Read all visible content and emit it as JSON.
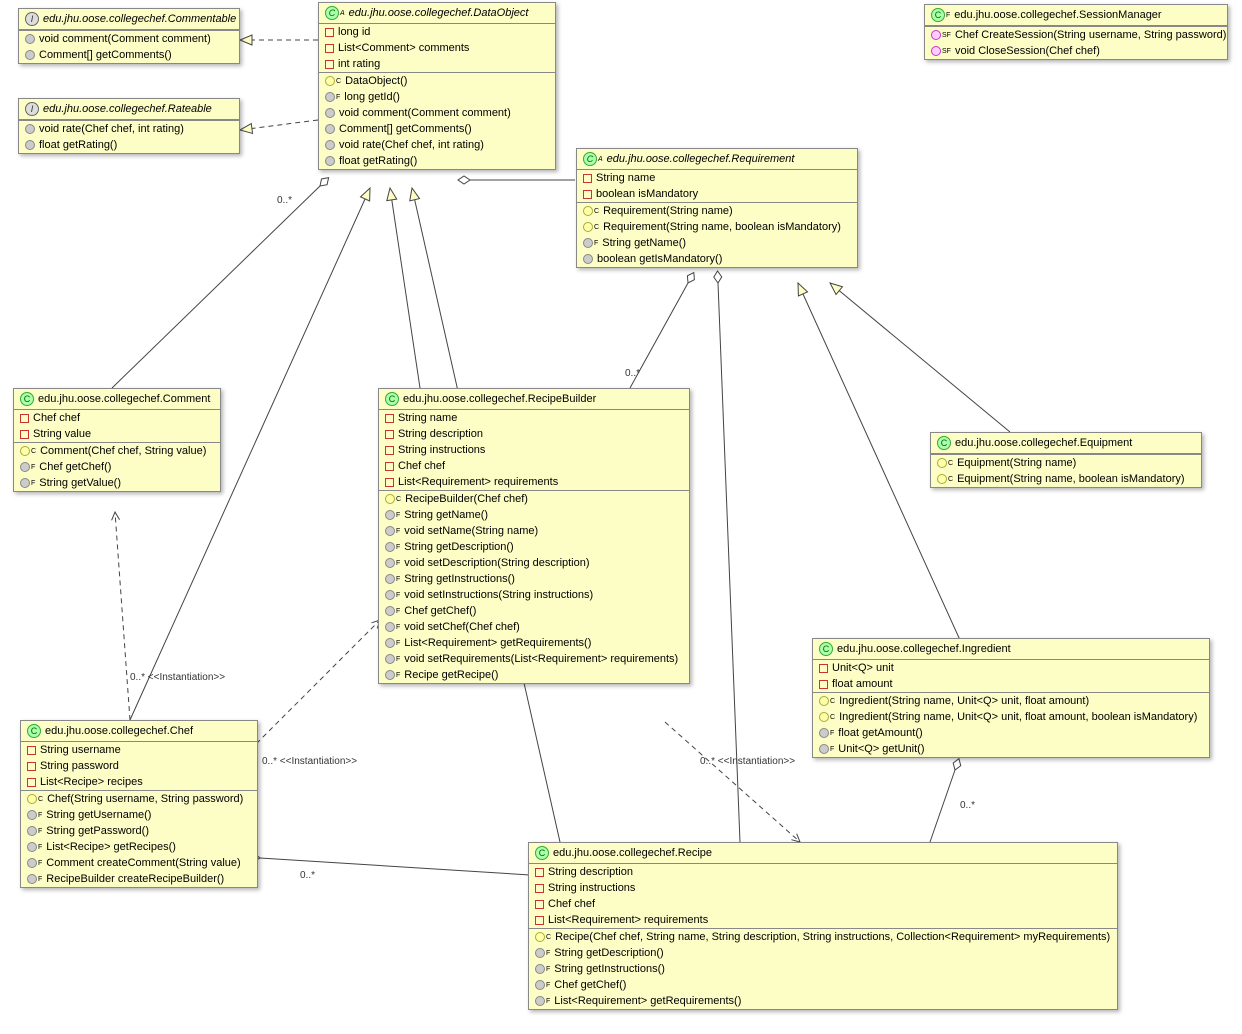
{
  "classes": {
    "commentable": {
      "title": "edu.jhu.oose.collegechef.Commentable",
      "methods": [
        "void comment(Comment comment)",
        "Comment[] getComments()"
      ]
    },
    "rateable": {
      "title": "edu.jhu.oose.collegechef.Rateable",
      "methods": [
        "void rate(Chef chef, int rating)",
        "float getRating()"
      ]
    },
    "dataobject": {
      "title": "edu.jhu.oose.collegechef.DataObject",
      "fields": [
        "long id",
        "List<Comment> comments",
        "int rating"
      ],
      "methods": [
        "DataObject()",
        "long getId()",
        "void comment(Comment comment)",
        "Comment[] getComments()",
        "void rate(Chef chef, int rating)",
        "float getRating()"
      ]
    },
    "sessionmanager": {
      "title": "edu.jhu.oose.collegechef.SessionManager",
      "methods": [
        "Chef CreateSession(String username, String password)",
        "void CloseSession(Chef chef)"
      ]
    },
    "requirement": {
      "title": "edu.jhu.oose.collegechef.Requirement",
      "fields": [
        "String name",
        "boolean isMandatory"
      ],
      "methods": [
        "Requirement(String name)",
        "Requirement(String name, boolean isMandatory)",
        "String getName()",
        "boolean getIsMandatory()"
      ]
    },
    "comment": {
      "title": "edu.jhu.oose.collegechef.Comment",
      "fields": [
        "Chef chef",
        "String value"
      ],
      "methods": [
        "Comment(Chef chef, String value)",
        "Chef getChef()",
        "String getValue()"
      ]
    },
    "recipebuilder": {
      "title": "edu.jhu.oose.collegechef.RecipeBuilder",
      "fields": [
        "String name",
        "String description",
        "String instructions",
        "Chef chef",
        "List<Requirement> requirements"
      ],
      "methods": [
        "RecipeBuilder(Chef chef)",
        "String getName()",
        "void setName(String name)",
        "String getDescription()",
        "void setDescription(String description)",
        "String getInstructions()",
        "void setInstructions(String instructions)",
        "Chef getChef()",
        "void setChef(Chef chef)",
        "List<Requirement> getRequirements()",
        "void setRequirements(List<Requirement> requirements)",
        "Recipe getRecipe()"
      ]
    },
    "equipment": {
      "title": "edu.jhu.oose.collegechef.Equipment",
      "methods": [
        "Equipment(String name)",
        "Equipment(String name, boolean isMandatory)"
      ]
    },
    "ingredient": {
      "title": "edu.jhu.oose.collegechef.Ingredient",
      "fields": [
        "Unit<Q> unit",
        "float amount"
      ],
      "methods": [
        "Ingredient(String name, Unit<Q> unit, float amount)",
        "Ingredient(String name, Unit<Q> unit, float amount, boolean isMandatory)",
        "float getAmount()",
        "Unit<Q> getUnit()"
      ]
    },
    "chef": {
      "title": "edu.jhu.oose.collegechef.Chef",
      "fields": [
        "String username",
        "String password",
        "List<Recipe> recipes"
      ],
      "methods": [
        "Chef(String username, String password)",
        "String getUsername()",
        "String getPassword()",
        "List<Recipe> getRecipes()",
        "Comment createComment(String value)",
        "RecipeBuilder createRecipeBuilder()"
      ]
    },
    "recipe": {
      "title": "edu.jhu.oose.collegechef.Recipe",
      "fields": [
        "String description",
        "String instructions",
        "Chef chef",
        "List<Requirement> requirements"
      ],
      "methods": [
        "Recipe(Chef chef, String name, String description, String instructions, Collection<Requirement> myRequirements)",
        "String getDescription()",
        "String getInstructions()",
        "Chef getChef()",
        "List<Requirement> getRequirements()"
      ]
    }
  },
  "labels": {
    "l1": "0..*",
    "l2": "0..*",
    "l3": "0..*  <<Instantiation>>",
    "l4": "0..*  <<Instantiation>>",
    "l5": "0..*  <<Instantiation>>",
    "l6": "0..*",
    "l7": "0..*"
  }
}
